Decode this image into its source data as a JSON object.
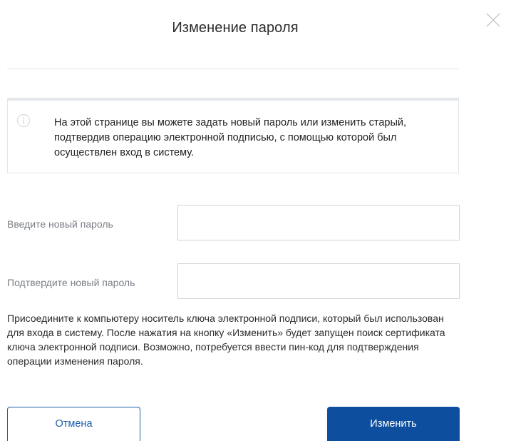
{
  "dialog": {
    "title": "Изменение пароля",
    "close_icon": "close-icon"
  },
  "info": {
    "icon": "info-icon",
    "text": "На этой странице вы можете задать новый пароль или изменить старый, подтвердив операцию электронной подписью, с помощью которой был осуществлен вход в систему."
  },
  "form": {
    "new_password": {
      "label": "Введите новый пароль",
      "value": "",
      "placeholder": ""
    },
    "confirm_password": {
      "label": "Подтвердите новый пароль",
      "value": "",
      "placeholder": ""
    }
  },
  "help_text": "Присоедините к компьютеру носитель ключа электронной подписи, который был использован для входа в систему. После нажатия на кнопку «Изменить» будет запущен поиск сертификата ключа электронной подписи. Возможно, потребуется ввести пин-код для подтверждения операции изменения пароля.",
  "buttons": {
    "cancel_label": "Отмена",
    "submit_label": "Изменить"
  },
  "colors": {
    "primary": "#0d4f9e",
    "border": "#cfd4d9",
    "label": "#7b7f85"
  }
}
